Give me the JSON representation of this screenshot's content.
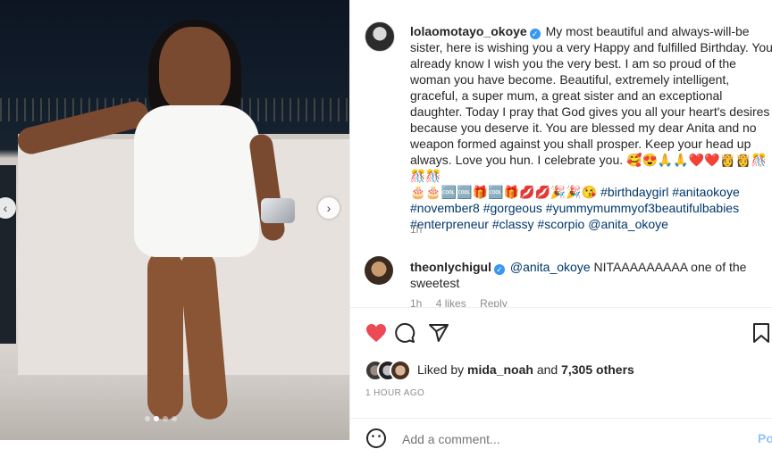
{
  "post": {
    "username": "lolaomotayo_okoye",
    "caption": "My most beautiful and always-will-be sister, here is wishing you a very Happy and fulfilled Birthday. You already know I wish you the very best. I am so proud of the woman you have become. Beautiful, extremely intelligent, graceful, a super mum, a great sister and an exceptional daughter. Today I pray that God gives you all your heart's desires because you deserve it. You are blessed my dear Anita and no weapon formed against you shall prosper. Keep your head up always. Love you hun. I celebrate you. 🥰😍🙏🙏❤️❤️👸👸🎊🎊🎊",
    "emoji_line": "🎂🎂🆒🆒🎁🆒🎁💋💋🎉🎉😘",
    "hashtags": [
      "#birthdaygirl",
      "#anitaokoye",
      "#november8",
      "#gorgeous",
      "#yummymummyof3beautifulbabies",
      "#enterpreneur",
      "#classy",
      "#scorpio"
    ],
    "mention": "@anita_okoye",
    "time_ago": "1h"
  },
  "comments": [
    {
      "username": "theonlychigul",
      "mention": "@anita_okoye",
      "text": "NITAAAAAAAAA one of the sweetest",
      "time_ago": "1h",
      "likes": "4 likes",
      "reply": "Reply"
    }
  ],
  "likes": {
    "prefix": "Liked by",
    "user": "mida_noah",
    "and": "and",
    "others": "7,305 others"
  },
  "timestamp": "1 HOUR AGO",
  "add_comment": {
    "placeholder": "Add a comment...",
    "post_label": "Post"
  },
  "icons": {
    "like": "heart-filled-icon",
    "comment": "comment-icon",
    "share": "share-icon",
    "save": "bookmark-icon",
    "emoji": "emoji-icon",
    "prev": "chevron-left-icon",
    "next": "chevron-right-icon"
  },
  "colors": {
    "like_red": "#ed4956",
    "verified_blue": "#3897f0",
    "hashtag_blue": "#00376b"
  },
  "carousel": {
    "slide_count": 4,
    "active_index": 1
  }
}
